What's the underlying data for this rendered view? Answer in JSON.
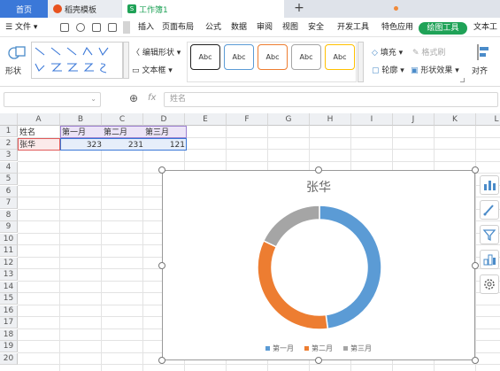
{
  "tabs": {
    "home": "首页",
    "docer": "稻壳模板",
    "workbook": "工作簿1"
  },
  "menu": {
    "file": "文件",
    "items": [
      "插入",
      "页面布局",
      "公式",
      "数据",
      "审阅",
      "视图",
      "安全",
      "开发工具",
      "特色应用"
    ],
    "drawing_tools": "绘图工具",
    "text_tools": "文本工"
  },
  "ribbon": {
    "shape_label": "形状",
    "edit_shape": "编辑形状",
    "text_box": "文本框",
    "style_boxes": [
      "Abc",
      "Abc",
      "Abc",
      "Abc",
      "Abc"
    ],
    "fill": "填充",
    "format_brush": "格式刷",
    "outline": "轮廓",
    "shape_effects": "形状效果",
    "align": "对齐"
  },
  "formula_bar": {
    "fx": "fx",
    "value": "姓名"
  },
  "grid": {
    "columns": [
      "A",
      "B",
      "C",
      "D",
      "E",
      "F",
      "G",
      "H",
      "I",
      "J",
      "K",
      "L"
    ],
    "rows": [
      "1",
      "2",
      "3",
      "4",
      "5",
      "6",
      "7",
      "8",
      "9",
      "10",
      "11",
      "12",
      "13",
      "14",
      "15",
      "16",
      "17",
      "18",
      "19",
      "20"
    ],
    "header_row": [
      "姓名",
      "第一月",
      "第二月",
      "第三月"
    ],
    "data_row": [
      "张华",
      "323",
      "231",
      "121"
    ]
  },
  "colors": {
    "accent": "#1fa257",
    "tab_blue": "#3b78d8",
    "s1": "#5b9bd5",
    "s2": "#ed7d31",
    "s3": "#a5a5a5"
  },
  "chart_data": {
    "type": "pie",
    "subtype": "doughnut",
    "title": "张华",
    "categories": [
      "第一月",
      "第二月",
      "第三月"
    ],
    "values": [
      323,
      231,
      121
    ],
    "legend": "bottom"
  }
}
